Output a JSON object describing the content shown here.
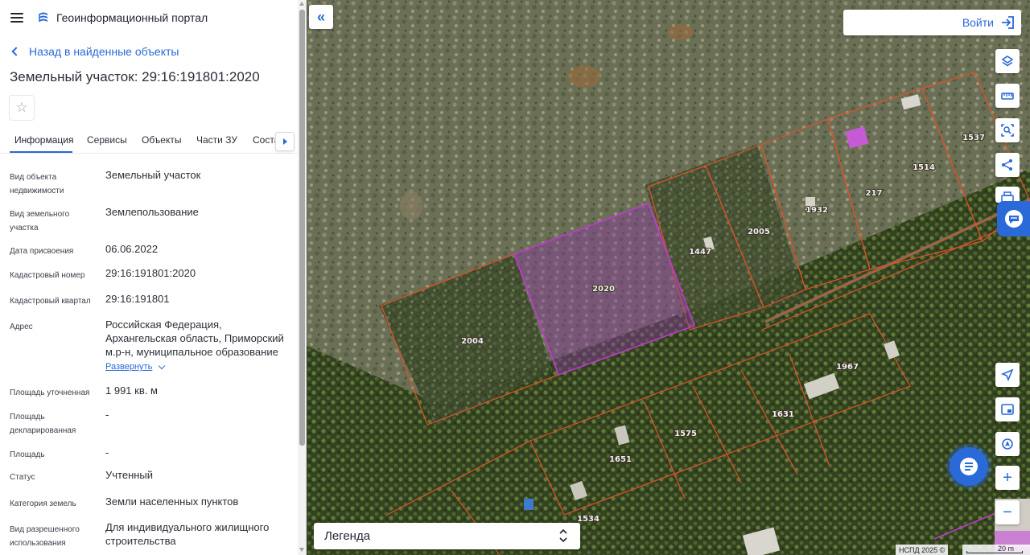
{
  "header": {
    "menu_icon": "hamburger-menu-icon",
    "logo_icon": "portal-logo-icon",
    "title": "Геоинформационный портал"
  },
  "back_link": "Назад в найденные объекты",
  "page_title": "Земельный участок: 29:16:191801:2020",
  "favorite_icon": "star-icon",
  "tabs": [
    {
      "label": "Информация",
      "active": true
    },
    {
      "label": "Сервисы"
    },
    {
      "label": "Объекты"
    },
    {
      "label": "Части ЗУ"
    },
    {
      "label": "Соста"
    }
  ],
  "info": [
    {
      "label": "Вид объекта недвижимости",
      "value": "Земельный участок"
    },
    {
      "label": "Вид земельного участка",
      "value": "Землепользование"
    },
    {
      "label": "Дата присвоения",
      "value": "06.06.2022"
    },
    {
      "label": "Кадастровый номер",
      "value": "29:16:191801:2020"
    },
    {
      "label": "Кадастровый квартал",
      "value": "29:16:191801"
    },
    {
      "label": "Адрес",
      "value": "Российская Федерация, Архангельская область, Приморский м.р-н, муниципальное образование",
      "expand": "Развернуть"
    },
    {
      "label": "Площадь уточненная",
      "value": "1 991 кв. м"
    },
    {
      "label": "Площадь декларированная",
      "value": "-"
    },
    {
      "label": "Площадь",
      "value": "-"
    },
    {
      "label": "Статус",
      "value": "Учтенный"
    },
    {
      "label": "Категория земель",
      "value": "Земли населенных пунктов"
    },
    {
      "label": "Вид разрешенного использования",
      "value": "Для индивидуального жилищного строительства"
    }
  ],
  "map": {
    "login_label": "Войти",
    "legend_label": "Легенда",
    "attribution": "НСПД 2025 ©",
    "scale_label": "20 m",
    "parcel_labels": [
      "2020",
      "2004",
      "1447",
      "2005",
      "1932",
      "217",
      "1514",
      "1537",
      "1967",
      "1631",
      "1575",
      "1651",
      "1534"
    ],
    "tools": [
      "layers-icon",
      "ruler-icon",
      "area-select-icon",
      "share-icon",
      "print-icon"
    ],
    "bottom_tools": [
      "navigate-icon",
      "minimap-icon",
      "geolocation-icon",
      "zoom-in-icon",
      "zoom-out-icon"
    ],
    "colors": {
      "accent": "#2a69d8",
      "selected_parcel": "#b13bc2",
      "parcel_border": "#e0522a"
    }
  }
}
